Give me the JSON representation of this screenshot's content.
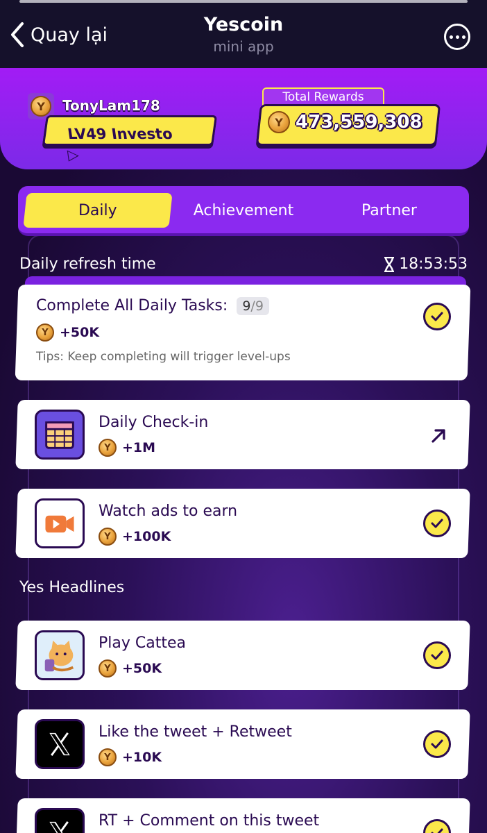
{
  "telegram": {
    "back_label": "Quay lại",
    "app_title": "Yescoin",
    "app_subtitle": "mini app",
    "menu_icon": "more-icon"
  },
  "profile": {
    "username": "TonyLam178",
    "level": "LV49 Investo",
    "total_rewards_label": "Total Rewards",
    "total_rewards_value": "473,559,308"
  },
  "tabs": [
    {
      "label": "Daily",
      "active": true
    },
    {
      "label": "Achievement",
      "active": false
    },
    {
      "label": "Partner",
      "active": false
    }
  ],
  "daily": {
    "refresh_label": "Daily refresh time",
    "refresh_timer": "18:53:53",
    "summary_task": {
      "title": "Complete All Daily Tasks:",
      "done": "9",
      "sep": "/",
      "total": "9",
      "reward": "+50K",
      "tips": "Tips: Keep completing will trigger level-ups",
      "status": "completed"
    },
    "tasks": [
      {
        "title": "Daily Check-in",
        "reward": "+1M",
        "icon": "calendar-icon",
        "status": "open"
      },
      {
        "title": "Watch ads to earn",
        "reward": "+100K",
        "icon": "video-camera-icon",
        "status": "completed"
      }
    ]
  },
  "headlines": {
    "label": "Yes Headlines",
    "tasks": [
      {
        "title": "Play Cattea",
        "reward": "+50K",
        "icon": "cattea-game-icon",
        "status": "completed"
      },
      {
        "title": "Like the tweet + Retweet",
        "reward": "+10K",
        "icon": "x-logo-icon",
        "status": "completed"
      },
      {
        "title": "RT + Comment on this tweet",
        "reward": "",
        "icon": "x-logo-icon",
        "status": "completed"
      }
    ]
  },
  "colors": {
    "accent_yellow": "#fbe84a",
    "brand_purple": "#8b2af0",
    "dark_text": "#2a0a52"
  }
}
